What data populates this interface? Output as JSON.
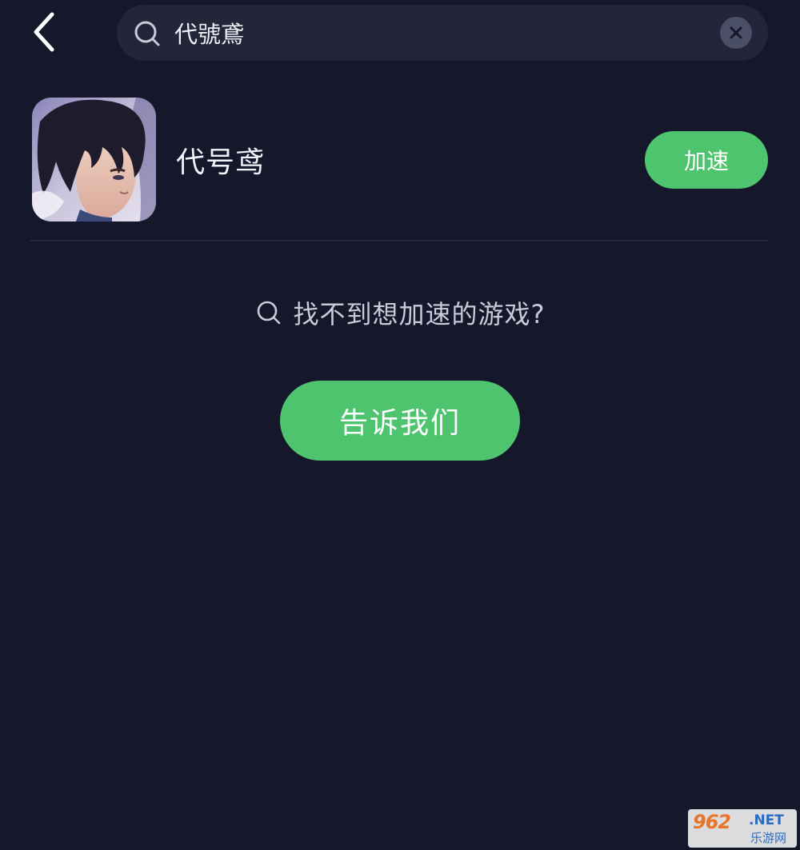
{
  "header": {
    "back_icon": "chevron-left-icon",
    "search": {
      "icon": "search-icon",
      "value": "代號鳶",
      "clear_icon": "close-icon"
    }
  },
  "results": [
    {
      "name": "代号鸢",
      "action_label": "加速"
    }
  ],
  "empty_hint": {
    "icon": "search-icon",
    "text": "找不到想加速的游戏?",
    "button_label": "告诉我们"
  },
  "watermark": {
    "main": "962",
    "suffix": ".NET",
    "sub": "乐游网"
  },
  "colors": {
    "background": "#15182a",
    "search_bg": "#232639",
    "accent": "#4fc46f",
    "divider": "#252a3d"
  }
}
